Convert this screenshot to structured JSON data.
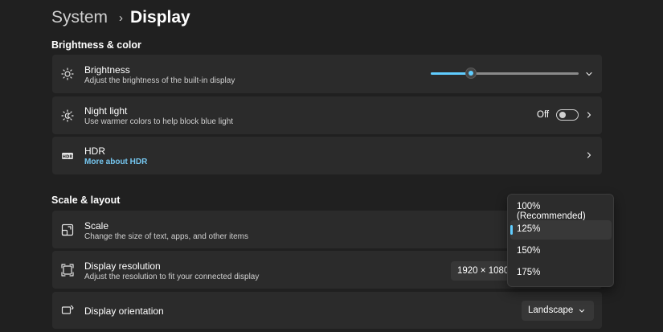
{
  "breadcrumb": {
    "parent": "System",
    "separator": "›",
    "current": "Display"
  },
  "sections": {
    "brightness_color": "Brightness & color",
    "scale_layout": "Scale & layout"
  },
  "brightness": {
    "title": "Brightness",
    "description": "Adjust the brightness of the built-in display",
    "level": 0.27
  },
  "night_light": {
    "title": "Night light",
    "description": "Use warmer colors to help block blue light",
    "state_label": "Off",
    "enabled": false
  },
  "hdr": {
    "title": "HDR",
    "link": "More about HDR"
  },
  "scale": {
    "title": "Scale",
    "description": "Change the size of text, apps, and other items",
    "options": [
      "100% (Recommended)",
      "125%",
      "150%",
      "175%"
    ],
    "selected": "125%"
  },
  "resolution": {
    "title": "Display resolution",
    "description": "Adjust the resolution to fit your connected display",
    "value": "1920 × 1080"
  },
  "orientation": {
    "title": "Display orientation",
    "value": "Landscape"
  },
  "icons": [
    "brightness-icon",
    "night-light-icon",
    "hdr-icon",
    "scale-icon",
    "resolution-icon",
    "orientation-icon",
    "chevron-down-icon",
    "chevron-right-icon"
  ],
  "colors": {
    "background": "#202020",
    "card": "#2b2b2b",
    "accent": "#60cdff",
    "link": "#75c6ef"
  }
}
